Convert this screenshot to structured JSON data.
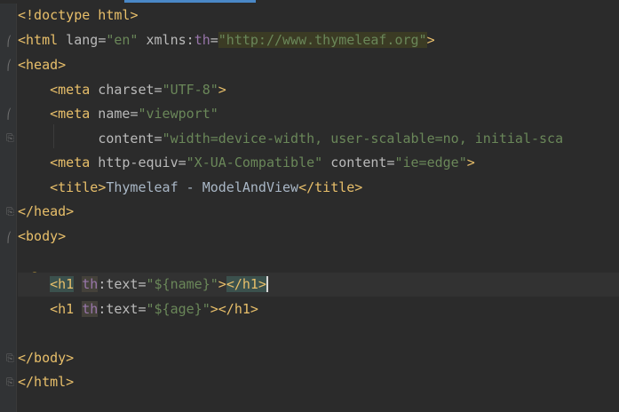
{
  "editor": {
    "lines": [
      {
        "text_parts": [
          "<!doctype",
          " html",
          ">"
        ]
      },
      {
        "tag_open": "<html",
        "attr1": " lang",
        "eq1": "=",
        "val1": "\"en\"",
        "attr2": " xmlns",
        "colon": ":",
        "ns": "th",
        "eq2": "=",
        "val2": "\"http://www.thymeleaf.org\"",
        "close": ">"
      },
      {
        "tag": "<head>"
      },
      {
        "tag_open": "<meta",
        "attr": " charset",
        "eq": "=",
        "val": "\"UTF-8\"",
        "close": ">"
      },
      {
        "tag_open": "<meta",
        "attr": " name",
        "eq": "=",
        "val": "\"viewport\""
      },
      {
        "attr": "content",
        "eq": "=",
        "val": "\"width=device-width, user-scalable=no, initial-sca"
      },
      {
        "tag_open": "<meta",
        "attr1": " http-equiv",
        "eq1": "=",
        "val1": "\"X-UA-Compatible\"",
        "attr2": " content",
        "eq2": "=",
        "val2": "\"ie=edge\"",
        "close": ">"
      },
      {
        "tag_open": "<title>",
        "text": "Thymeleaf - ModelAndView",
        "tag_close": "</title>"
      },
      {
        "tag": "</head>"
      },
      {
        "tag": "<body>"
      },
      {
        "tag_open": "<h1",
        "ns": "th",
        "colon": ":",
        "attr": "text",
        "eq": "=",
        "val": "\"${name}\"",
        "gt": ">",
        "tag_close": "</h1>"
      },
      {
        "tag_open": "<h1",
        "ns": "th",
        "colon": ":",
        "attr": "text",
        "eq": "=",
        "val": "\"${age}\"",
        "gt": ">",
        "tag_close": "</h1>"
      },
      {
        "tag": "</body>"
      },
      {
        "tag": "</html>"
      }
    ]
  },
  "icons": {
    "fold": "fold-marker-icon",
    "bulb": "lightbulb-icon"
  },
  "colors": {
    "background": "#2b2b2b",
    "tag": "#e8bf6a",
    "attribute": "#bababa",
    "value": "#6a8759",
    "namespace": "#9876aa",
    "bulb": "#f0c040"
  }
}
